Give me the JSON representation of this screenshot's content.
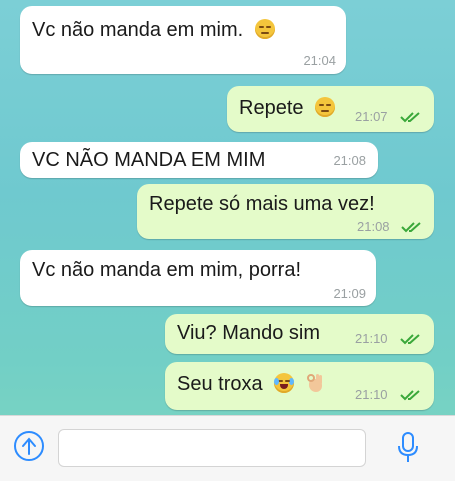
{
  "messages": [
    {
      "text": "Vc não manda em mim.",
      "time": "21:04",
      "direction": "incoming",
      "emoji": "relieved-face"
    },
    {
      "text": "Repete",
      "time": "21:07",
      "direction": "outgoing",
      "emoji": "unamused-face",
      "read": true
    },
    {
      "text": "VC NÃO MANDA EM MIM",
      "time": "21:08",
      "direction": "incoming"
    },
    {
      "text": "Repete só mais uma vez!",
      "time": "21:08",
      "direction": "outgoing",
      "read": true
    },
    {
      "text": "Vc não manda em mim, porra!",
      "time": "21:09",
      "direction": "incoming"
    },
    {
      "text": "Viu? Mando sim",
      "time": "21:10",
      "direction": "outgoing",
      "read": true
    },
    {
      "text": "Seu troxa",
      "time": "21:10",
      "direction": "outgoing",
      "emoji": "joy-face ok-hand",
      "read": true
    }
  ],
  "composer": {
    "placeholder": ""
  },
  "colors": {
    "incoming": "#ffffff",
    "outgoing": "#e4fbc9",
    "ticks": "#3aa83a",
    "accent": "#2d8cff"
  }
}
